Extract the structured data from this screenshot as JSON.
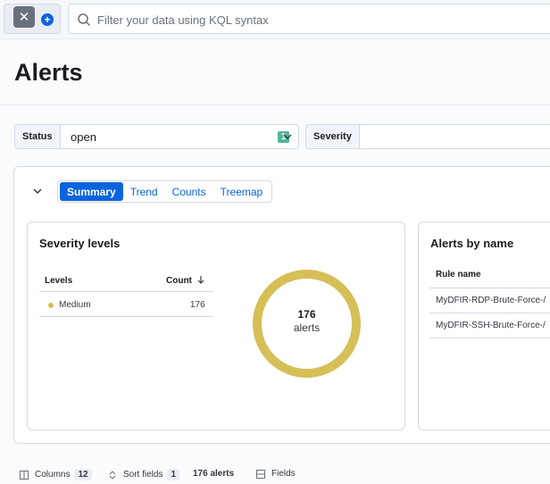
{
  "search": {
    "placeholder": "Filter your data using KQL syntax"
  },
  "page": {
    "title": "Alerts"
  },
  "filters": {
    "status": {
      "label": "Status",
      "value": "open",
      "count": "1"
    },
    "severity": {
      "label": "Severity"
    }
  },
  "tabs": [
    "Summary",
    "Trend",
    "Counts",
    "Treemap"
  ],
  "severity_panel": {
    "title": "Severity levels",
    "headers": {
      "levels": "Levels",
      "count": "Count"
    },
    "rows": [
      {
        "level": "Medium",
        "count": "176",
        "color": "#d6bf57"
      }
    ],
    "donut": {
      "value": "176",
      "label": "alerts",
      "fraction": 1.0,
      "color": "#d6bf57"
    }
  },
  "name_panel": {
    "title": "Alerts by name",
    "header": "Rule name",
    "rows": [
      "MyDFIR-RDP-Brute-Force-/",
      "MyDFIR-SSH-Brute-Force-/"
    ]
  },
  "footer": {
    "columns_label": "Columns",
    "columns_count": "12",
    "sort_label": "Sort fields",
    "sort_count": "1",
    "alerts_total": "176 alerts",
    "fields_label": "Fields"
  }
}
